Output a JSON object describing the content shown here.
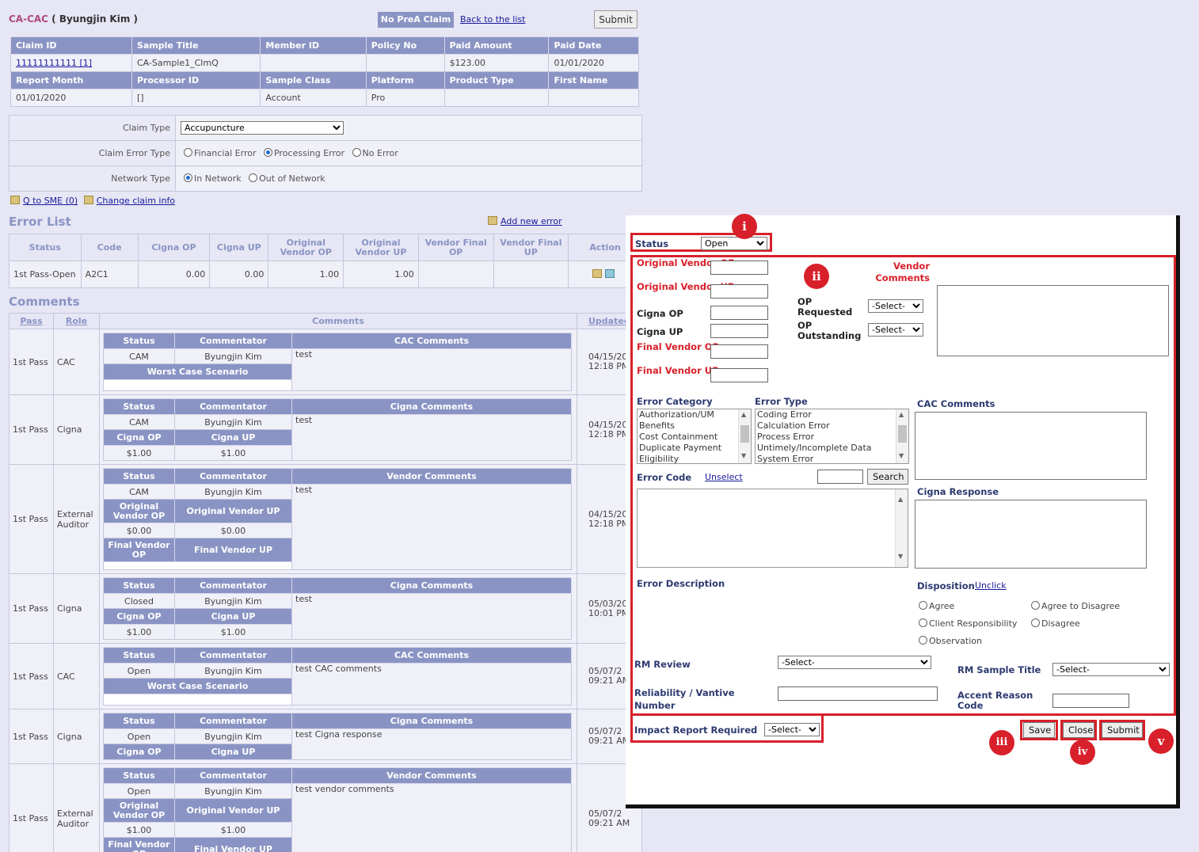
{
  "header": {
    "title_code": "CA-CAC",
    "title_name": "( Byungjin Kim )",
    "no_prea_label": "No PreA Claim",
    "back_link": "Back to the list",
    "submit_label": "Submit"
  },
  "claim_info": {
    "row1_headers": [
      "Claim ID",
      "Sample Title",
      "Member ID",
      "Policy No",
      "Paid Amount",
      "Paid Date"
    ],
    "row1_values": [
      "11111111111 [1]",
      "CA-Sample1_ClmQ",
      "",
      "",
      "$123.00",
      "01/01/2020"
    ],
    "row2_headers": [
      "Report Month",
      "Processor ID",
      "Sample Class",
      "Platform",
      "Product Type",
      "First Name"
    ],
    "row2_values": [
      "01/01/2020",
      "[]",
      "Account",
      "Pro",
      "",
      ""
    ]
  },
  "claim_type": {
    "label": "Claim Type",
    "value": "Accupuncture",
    "error_type_label": "Claim Error Type",
    "error_type_options": [
      "Financial Error",
      "Processing Error",
      "No Error"
    ],
    "network_label": "Network Type",
    "network_options": [
      "In Network",
      "Out of Network"
    ]
  },
  "links": {
    "q_sme": "Q to SME (0)",
    "change_claim": "Change claim info",
    "add_error": "Add new error"
  },
  "error_list": {
    "title": "Error List",
    "headers": [
      "Status",
      "Code",
      "Cigna OP",
      "Cigna UP",
      "Original Vendor OP",
      "Original Vendor UP",
      "Vendor Final OP",
      "Vendor Final UP",
      "Action"
    ],
    "row": [
      "1st Pass-Open",
      "A2C1",
      "0.00",
      "0.00",
      "1.00",
      "1.00",
      "",
      ""
    ]
  },
  "comments": {
    "title": "Comments",
    "headers": {
      "pass": "Pass",
      "role": "Role",
      "comments": "Comments",
      "updated": "Updated"
    },
    "rows": [
      {
        "pass": "1st Pass",
        "role": "CAC",
        "h3": "CAC Comments",
        "status": "CAM",
        "commentator": "Byungjin Kim",
        "text": "test",
        "extra": "Worst Case Scenario",
        "date": "04/15/20",
        "time": "12:18 PM"
      },
      {
        "pass": "1st Pass",
        "role": "Cigna",
        "h3": "Cigna Comments",
        "status": "CAM",
        "commentator": "Byungjin Kim",
        "text": "test",
        "op_l": "Cigna OP",
        "up_l": "Cigna UP",
        "op": "$1.00",
        "up": "$1.00",
        "date": "04/15/20",
        "time": "12:18 PM"
      },
      {
        "pass": "1st Pass",
        "role": "External Auditor",
        "h3": "Vendor Comments",
        "status": "CAM",
        "commentator": "Byungjin Kim",
        "text": "test",
        "op_l": "Original Vendor OP",
        "up_l": "Original Vendor UP",
        "op": "$0.00",
        "up": "$0.00",
        "fop_l": "Final Vendor OP",
        "fup_l": "Final Vendor UP",
        "date": "04/15/20",
        "time": "12:18 PM"
      },
      {
        "pass": "1st Pass",
        "role": "Cigna",
        "h3": "Cigna Comments",
        "status": "Closed",
        "commentator": "Byungjin Kim",
        "text": "test",
        "op_l": "Cigna OP",
        "up_l": "Cigna UP",
        "op": "$1.00",
        "up": "$1.00",
        "date": "05/03/20",
        "time": "10:01 PM"
      },
      {
        "pass": "1st Pass",
        "role": "CAC",
        "h3": "CAC Comments",
        "status": "Open",
        "commentator": "Byungjin Kim",
        "text": "test CAC comments",
        "extra": "Worst Case Scenario",
        "date": "05/07/2",
        "time": "09:21 AM"
      },
      {
        "pass": "1st Pass",
        "role": "Cigna",
        "h3": "Cigna Comments",
        "status": "Open",
        "commentator": "Byungjin Kim",
        "text": "test Cigna response",
        "op_l": "Cigna OP",
        "up_l": "Cigna UP",
        "date": "05/07/2",
        "time": "09:21 AM"
      },
      {
        "pass": "1st Pass",
        "role": "External Auditor",
        "h3": "Vendor Comments",
        "status": "Open",
        "commentator": "Byungjin Kim",
        "text": "test vendor comments",
        "op_l": "Original Vendor OP",
        "up_l": "Original Vendor UP",
        "op": "$1.00",
        "up": "$1.00",
        "fop_l": "Final Vendor OP",
        "fup_l": "Final Vendor UP",
        "date": "05/07/2",
        "time": "09:21 AM"
      }
    ],
    "status_h": "Status",
    "commentator_h": "Commentator"
  },
  "dialog": {
    "status_label": "Status",
    "status_value": "Open",
    "orig_vendor_op": "Original Vendor OP",
    "orig_vendor_up": "Original Vendor UP",
    "cigna_op": "Cigna OP",
    "cigna_up": "Cigna UP",
    "final_vendor_op": "Final Vendor OP",
    "final_vendor_up": "Final Vendor UP",
    "op_requested": "OP Requested",
    "op_outstanding": "OP Outstanding",
    "select": "-Select-",
    "vendor_comments": "Vendor Comments",
    "error_category": "Error Category",
    "error_category_items": [
      "Authorization/UM",
      "Benefits",
      "Cost Containment",
      "Duplicate Payment",
      "Eligibility"
    ],
    "error_type": "Error Type",
    "error_type_items": [
      "Coding Error",
      "Calculation Error",
      "Process Error",
      "Untimely/Incomplete Data",
      "System Error"
    ],
    "cac_comments": "CAC Comments",
    "error_code": "Error Code",
    "unselect": "Unselect",
    "search": "Search",
    "cigna_response": "Cigna Response",
    "error_description": "Error Description",
    "disposition": "Disposition",
    "unclick": "Unclick",
    "disp_options": [
      "Agree",
      "Agree to Disagree",
      "Client Responsibility",
      "Disagree",
      "Observation"
    ],
    "rm_review": "RM Review",
    "rm_sample_title": "RM Sample Title",
    "reliability": "Reliability / Vantive Number",
    "accent_reason": "Accent Reason Code",
    "impact_report": "Impact Report Required",
    "save": "Save",
    "close": "Close",
    "submit": "Submit"
  },
  "badges": [
    "i",
    "ii",
    "iii",
    "iv",
    "v"
  ],
  "colors": {
    "accent": "#8a94c4",
    "highlight": "#d8202a",
    "background": "#e6e6f5"
  }
}
